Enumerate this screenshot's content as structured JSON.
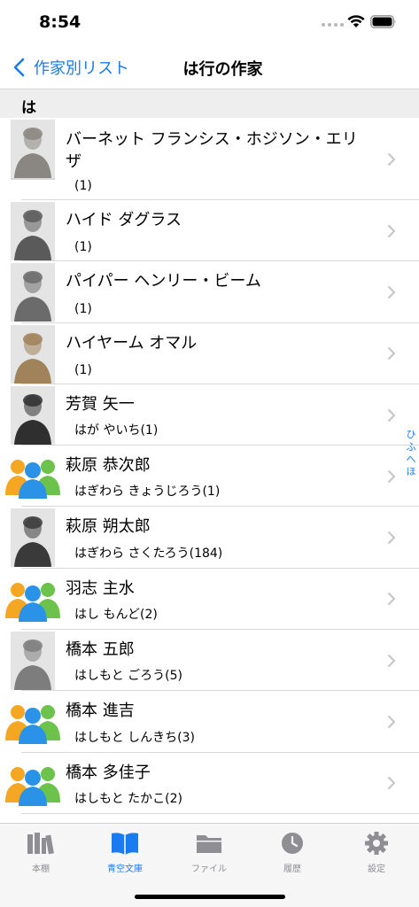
{
  "status_bar": {
    "time": "8:54"
  },
  "nav": {
    "back_label": "作家別リスト",
    "title": "は行の作家"
  },
  "section": {
    "label": "は"
  },
  "authors": [
    {
      "name": "バーネット フランシス・ホジソン・エリザ",
      "reading": "(1)",
      "thumb": "portrait",
      "tone": "#8a8782"
    },
    {
      "name": "ハイド ダグラス",
      "reading": "(1)",
      "thumb": "portrait",
      "tone": "#5a5a5a"
    },
    {
      "name": "パイパー ヘンリー・ビーム",
      "reading": "(1)",
      "thumb": "portrait",
      "tone": "#6b6b6b"
    },
    {
      "name": "ハイヤーム オマル",
      "reading": "(1)",
      "thumb": "portrait",
      "tone": "#a0835a"
    },
    {
      "name": "芳賀 矢一",
      "reading": "はが やいち(1)",
      "thumb": "portrait",
      "tone": "#2f2f2f"
    },
    {
      "name": "萩原 恭次郎",
      "reading": "はぎわら きょうじろう(1)",
      "thumb": "group"
    },
    {
      "name": "萩原 朔太郎",
      "reading": "はぎわら さくたろう(184)",
      "thumb": "portrait",
      "tone": "#3a3a3a"
    },
    {
      "name": "羽志 主水",
      "reading": "はし もんど(2)",
      "thumb": "group"
    },
    {
      "name": "橋本 五郎",
      "reading": "はしもと ごろう(5)",
      "thumb": "portrait",
      "tone": "#7d7d7d"
    },
    {
      "name": "橋本 進吉",
      "reading": "はしもと しんきち(3)",
      "thumb": "group"
    },
    {
      "name": "橋本 多佳子",
      "reading": "はしもと たかこ(2)",
      "thumb": "group"
    }
  ],
  "index": [
    "ひ",
    "ふ",
    "へ",
    "ほ"
  ],
  "tabs": [
    {
      "label": "本棚",
      "icon": "bookshelf-icon"
    },
    {
      "label": "青空文庫",
      "icon": "open-book-icon"
    },
    {
      "label": "ファイル",
      "icon": "folder-icon"
    },
    {
      "label": "履歴",
      "icon": "clock-icon"
    },
    {
      "label": "設定",
      "icon": "gear-icon"
    }
  ],
  "colors": {
    "accent": "#1a7bf0",
    "inactive": "#8e8e93",
    "section_bg": "#eeeeef"
  }
}
